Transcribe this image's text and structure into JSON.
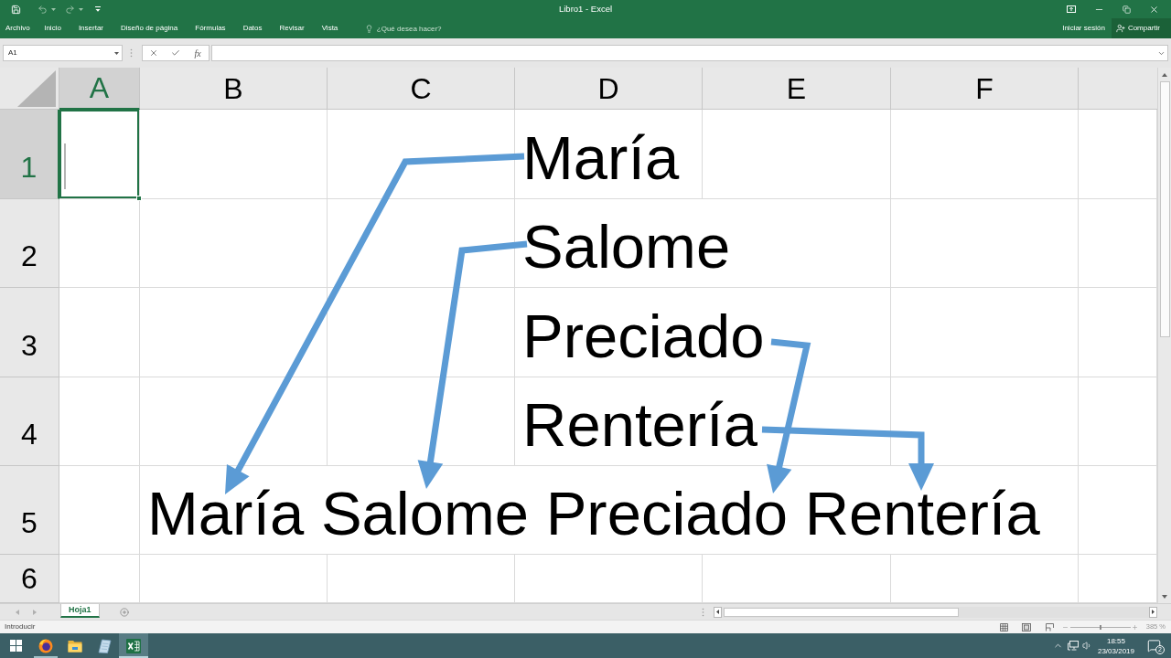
{
  "window": {
    "title": "Libro1 - Excel"
  },
  "quick_access": [
    {
      "kind": "save",
      "disabled": false
    },
    {
      "kind": "undo",
      "disabled": true
    },
    {
      "kind": "redo",
      "disabled": true
    }
  ],
  "ribbon": {
    "tabs": [
      {
        "label": "Archivo",
        "selected": false
      },
      {
        "label": "Inicio",
        "selected": false
      },
      {
        "label": "Insertar",
        "selected": false
      },
      {
        "label": "Diseño de página",
        "selected": false
      },
      {
        "label": "Fórmulas",
        "selected": false
      },
      {
        "label": "Datos",
        "selected": false
      },
      {
        "label": "Revisar",
        "selected": false
      },
      {
        "label": "Vista",
        "selected": false
      }
    ],
    "search": {
      "placeholder": "¿Qué desea hacer?"
    },
    "sign_in": "Iniciar sesión",
    "share": "Compartir"
  },
  "formula_bar": {
    "name_box": "A1",
    "function_button": "fx",
    "editing": true
  },
  "sheet": {
    "columns": [
      {
        "label": "A",
        "selected": true
      },
      {
        "label": "B",
        "selected": false
      },
      {
        "label": "C",
        "selected": false
      },
      {
        "label": "D",
        "selected": false
      },
      {
        "label": "E",
        "selected": false
      },
      {
        "label": "F",
        "selected": false
      }
    ],
    "rows": [
      {
        "label": "1",
        "selected": true,
        "cells": [
          null,
          null,
          null,
          "María"
        ]
      },
      {
        "label": "2",
        "selected": false,
        "cells": [
          null,
          null,
          null,
          "Salome"
        ]
      },
      {
        "label": "3",
        "selected": false,
        "cells": [
          null,
          null,
          null,
          "Preciado"
        ]
      },
      {
        "label": "4",
        "selected": false,
        "cells": [
          null,
          null,
          null,
          "Rentería"
        ]
      },
      {
        "label": "5",
        "selected": false,
        "cells": [
          null,
          "María Salome Preciado Rentería"
        ]
      },
      {
        "label": "6",
        "selected": false
      }
    ]
  },
  "sheet_tabs": [
    {
      "label": "Hoja1",
      "selected": true
    }
  ],
  "status_bar": {
    "mode": "Introducir",
    "zoom": {
      "level": 0.5,
      "reading": "385 %"
    }
  },
  "taskbar": {
    "apps": [
      {
        "kind": "browser",
        "running": true,
        "selected": false
      },
      {
        "kind": "folder",
        "running": false,
        "selected": false
      },
      {
        "kind": "notes",
        "running": false,
        "selected": false
      },
      {
        "kind": "spreadsheet",
        "running": true,
        "selected": true
      }
    ],
    "time": "18:55",
    "date": "23/03/2019",
    "notifications": "2"
  }
}
